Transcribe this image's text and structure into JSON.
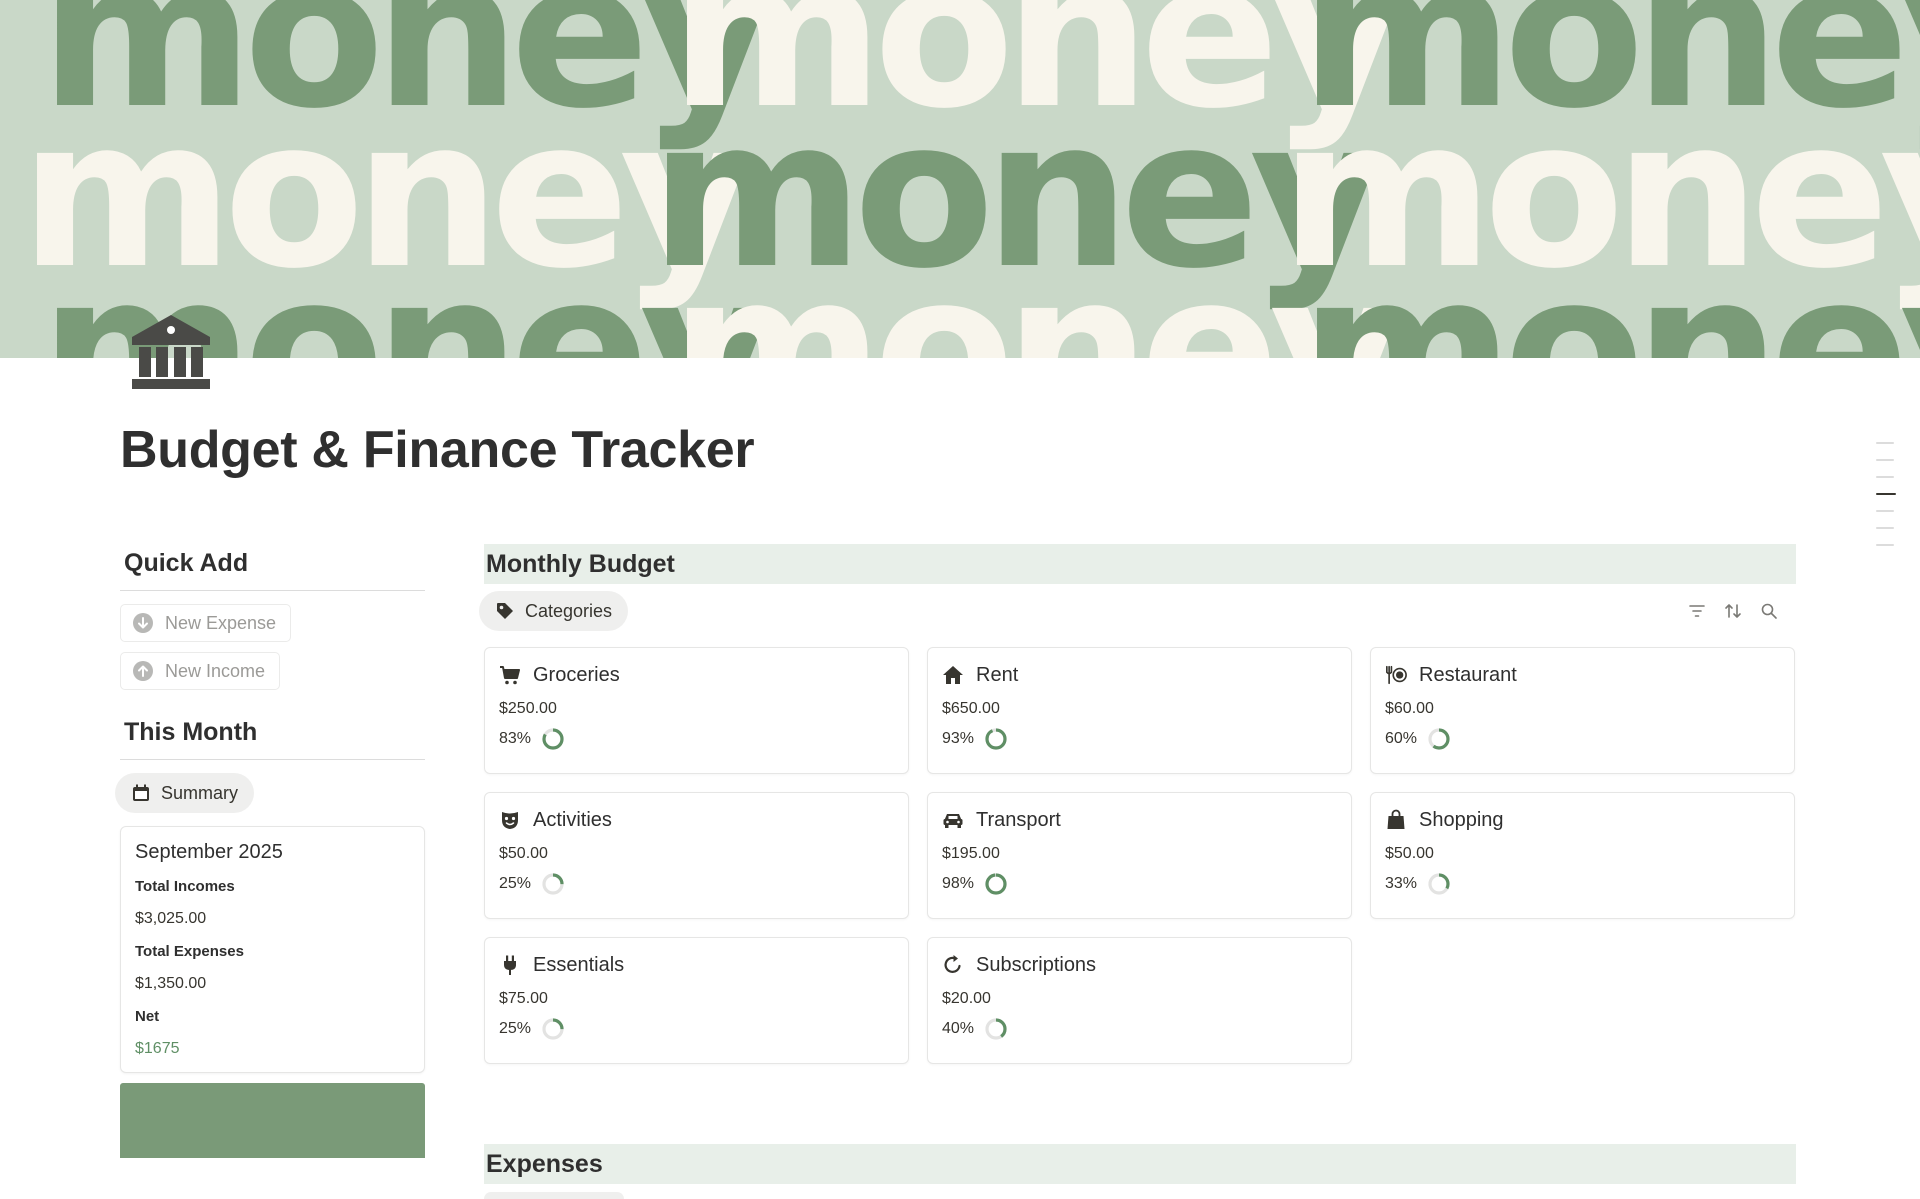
{
  "cover": {
    "word": "money",
    "colors": {
      "background": "#c9d8c8",
      "green": "#7a9b78",
      "cream": "#f8f5ec"
    }
  },
  "page": {
    "icon": "bank-icon",
    "title": "Budget & Finance Tracker"
  },
  "quick_add": {
    "heading": "Quick Add",
    "buttons": [
      {
        "label": "New Expense",
        "icon": "arrow-down-circle-icon"
      },
      {
        "label": "New Income",
        "icon": "arrow-up-circle-icon"
      }
    ]
  },
  "this_month": {
    "heading": "This Month",
    "view_tab": "Summary",
    "card": {
      "month": "September 2025",
      "total_incomes_label": "Total Incomes",
      "total_incomes": "$3,025.00",
      "total_expenses_label": "Total Expenses",
      "total_expenses": "$1,350.00",
      "net_label": "Net",
      "net": "$1675"
    }
  },
  "monthly_budget": {
    "heading": "Monthly Budget",
    "view_tab": "Categories",
    "tools": [
      "filter-icon",
      "sort-icon",
      "search-icon"
    ],
    "categories": [
      {
        "name": "Groceries",
        "icon": "cart-icon",
        "amount": "$250.00",
        "percent": "83%",
        "progress": 0.83
      },
      {
        "name": "Rent",
        "icon": "house-icon",
        "amount": "$650.00",
        "percent": "93%",
        "progress": 0.93
      },
      {
        "name": "Restaurant",
        "icon": "utensils-icon",
        "amount": "$60.00",
        "percent": "60%",
        "progress": 0.6
      },
      {
        "name": "Activities",
        "icon": "mask-icon",
        "amount": "$50.00",
        "percent": "25%",
        "progress": 0.25
      },
      {
        "name": "Transport",
        "icon": "car-icon",
        "amount": "$195.00",
        "percent": "98%",
        "progress": 0.98
      },
      {
        "name": "Shopping",
        "icon": "shopping-bag-icon",
        "amount": "$50.00",
        "percent": "33%",
        "progress": 0.33
      },
      {
        "name": "Essentials",
        "icon": "plug-icon",
        "amount": "$75.00",
        "percent": "25%",
        "progress": 0.25
      },
      {
        "name": "Subscriptions",
        "icon": "refresh-icon",
        "amount": "$20.00",
        "percent": "40%",
        "progress": 0.4
      }
    ]
  },
  "expenses": {
    "heading": "Expenses"
  },
  "colors": {
    "accent_green": "#5f8f65",
    "band": "#e8efe9",
    "ring_track": "#e3e3e2"
  }
}
